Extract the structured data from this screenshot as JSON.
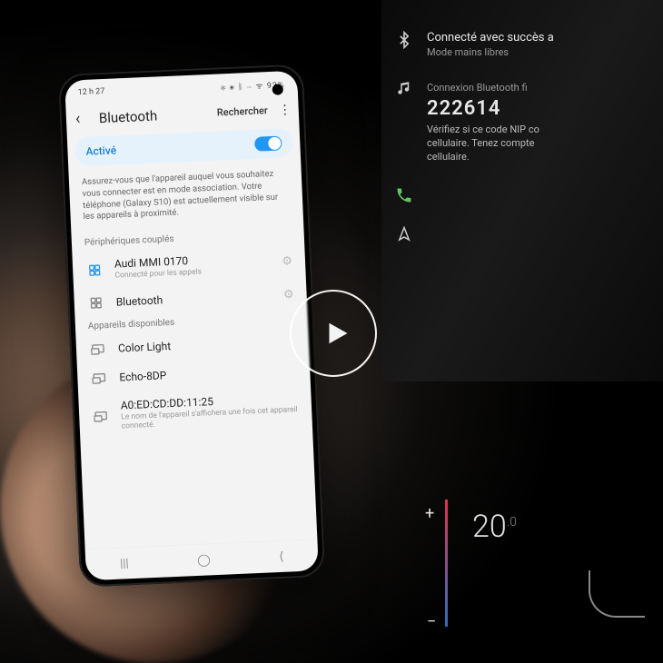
{
  "phone": {
    "status": {
      "time": "12 h 27",
      "icons": "✻ ⦿ ᛒ ⋯ ᯤ ",
      "battery": "93%"
    },
    "header": {
      "title": "Bluetooth",
      "search": "Rechercher"
    },
    "pill": {
      "label": "Activé"
    },
    "help": "Assurez-vous que l'appareil auquel vous souhaitez vous connecter est en mode association. Votre téléphone (Galaxy S10) est actuellement visible sur les appareils à proximité.",
    "section_paired": "Périphériques couplés",
    "paired": [
      {
        "name": "Audi MMI 0170",
        "sub": "Connecté pour les appels",
        "gear": true,
        "blue": true
      },
      {
        "name": "Bluetooth",
        "sub": "",
        "gear": true,
        "blue": false
      }
    ],
    "section_avail": "Appareils disponibles",
    "available": [
      {
        "name": "Color Light",
        "sub": ""
      },
      {
        "name": "Echo-8DP",
        "sub": ""
      },
      {
        "name": "A0:ED:CD:DD:11:25",
        "sub": "Le nom de l'appareil s'affichera une fois cet appareil connecté."
      }
    ]
  },
  "dash": {
    "bt_status": "Connecté avec succès a",
    "bt_sub": "Mode mains libres",
    "conn_label": "Connexion Bluetooth fi",
    "pin": "222614",
    "note": "Vérifiez si ce code NIP co\ncellulaire. Tenez compte\ncellulaire."
  },
  "climate": {
    "temp": "20",
    "temp_dec": ".0"
  }
}
